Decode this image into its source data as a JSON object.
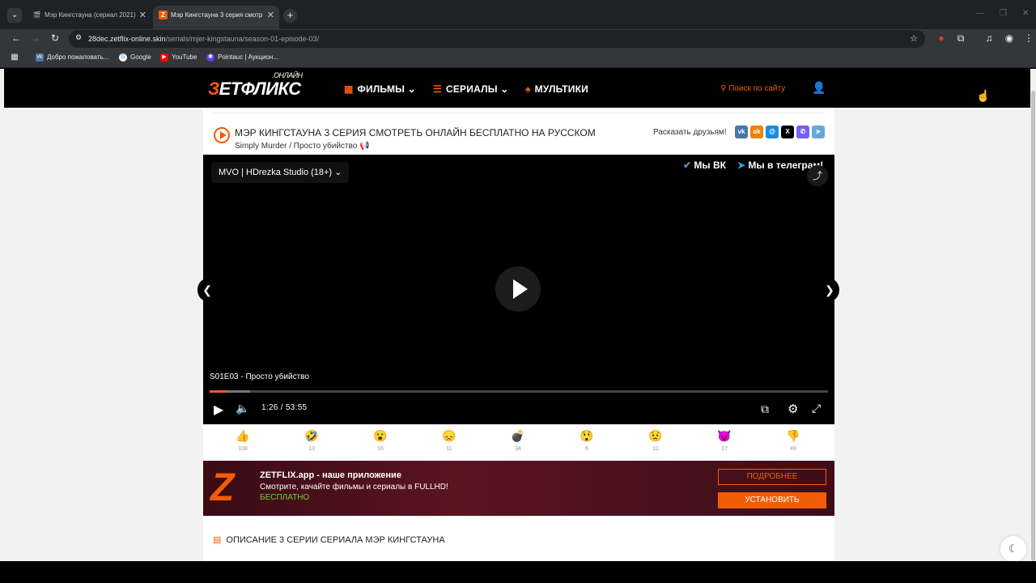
{
  "browser": {
    "tabs": [
      {
        "label": "Мэр Кингстауна (сериал 2021)",
        "active": false
      },
      {
        "label": "Мэр Кингстауна 3 серия смотр",
        "active": true
      }
    ],
    "url_host": "28dec.zetflix-online.skin",
    "url_path": "/serials/mjer-kingstauna/season-01-episode-03/",
    "bookmarks": [
      "Добро пожаловать...",
      "Google",
      "YouTube",
      "Pointauc | Аукцион..."
    ]
  },
  "site": {
    "logo": {
      "main": "ЕТФЛИКС",
      "z": "З",
      "small": ".ОНЛАЙН"
    },
    "menu": [
      {
        "label": "ФИЛЬМЫ",
        "icon": "film-icon"
      },
      {
        "label": "СЕРИАЛЫ",
        "icon": "list-icon"
      },
      {
        "label": "МУЛЬТИКИ",
        "icon": "rocket-icon"
      }
    ],
    "search_label": "Поиск по сайту",
    "page_title": "МЭР КИНГСТАУНА 3 СЕРИЯ СМОТРЕТЬ ОНЛАЙН БЕСПЛАТНО НА РУССКОМ",
    "subtitle": "Simply Murder / Просто убийство",
    "share_label": "Расказать друзьям!",
    "share_buttons": [
      {
        "name": "vk",
        "glyph": "vk",
        "color": "#4a76a8"
      },
      {
        "name": "ok",
        "glyph": "ok",
        "color": "#ee8208"
      },
      {
        "name": "mail",
        "glyph": "@",
        "color": "#168de2"
      },
      {
        "name": "x",
        "glyph": "X",
        "color": "#000000"
      },
      {
        "name": "viber",
        "glyph": "✆",
        "color": "#7360f2"
      },
      {
        "name": "telegram",
        "glyph": "➤",
        "color": "#64a9dc"
      }
    ]
  },
  "player": {
    "voice": "MVO | HDrezka Studio (18+)",
    "vk_promo": "Мы ВК",
    "tg_promo": "Мы в телеграм!",
    "episode": "S01E03 - Просто убийство",
    "time": "1:26 / 53:55",
    "progress": 0.027,
    "buffered": 0.065
  },
  "reactions": [
    {
      "emoji": "👍",
      "count": "108"
    },
    {
      "emoji": "🤣",
      "count": "13"
    },
    {
      "emoji": "😮",
      "count": "16"
    },
    {
      "emoji": "😞",
      "count": "11"
    },
    {
      "emoji": "💣",
      "count": "34"
    },
    {
      "emoji": "😲",
      "count": "6"
    },
    {
      "emoji": "😟",
      "count": "10"
    },
    {
      "emoji": "😈",
      "count": "17"
    },
    {
      "emoji": "👎",
      "count": "49"
    }
  ],
  "banner": {
    "title": "ZETFLIX.app - наше приложение",
    "text": "Смотрите, качайте фильмы и сериалы в FULLHD!",
    "free": "БЕСПЛАТНО",
    "more": "ПОДРОБНЕЕ",
    "install": "УСТАНОВИТЬ"
  },
  "description_heading": "ОПИСАНИЕ 3 СЕРИИ СЕРИАЛА МЭР КИНГСТАУНА"
}
